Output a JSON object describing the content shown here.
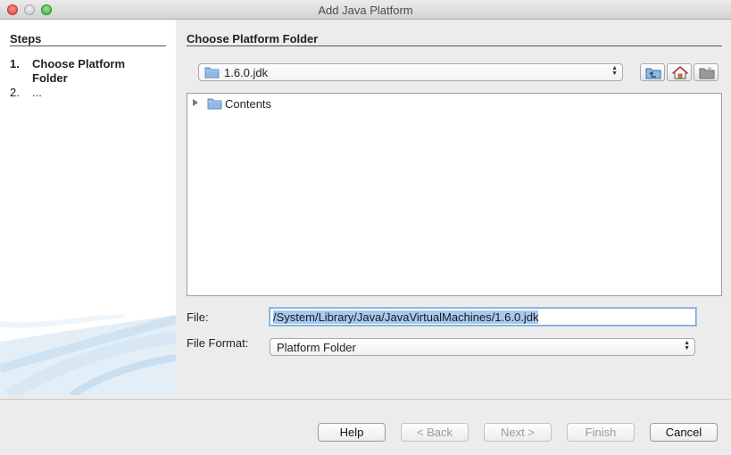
{
  "window": {
    "title": "Add Java Platform"
  },
  "steps": {
    "heading": "Steps",
    "items": [
      {
        "num": "1.",
        "label": "Choose Platform Folder",
        "active": true
      },
      {
        "num": "2.",
        "label": "...",
        "active": false
      }
    ]
  },
  "main": {
    "heading": "Choose Platform Folder",
    "folder_combo": {
      "value": "1.6.0.jdk",
      "icon": "folder-icon"
    },
    "toolbar": {
      "up_icon": "up-one-level-icon",
      "home_icon": "home-icon",
      "new_folder_icon": "new-folder-icon"
    },
    "tree": {
      "rows": [
        {
          "label": "Contents",
          "icon": "folder-icon",
          "expanded": false
        }
      ]
    },
    "file_label": "File:",
    "file_value": "/System/Library/Java/JavaVirtualMachines/1.6.0.jdk",
    "format_label": "File Format:",
    "format_value": "Platform Folder"
  },
  "buttons": {
    "help": "Help",
    "back": "< Back",
    "next": "Next >",
    "finish": "Finish",
    "cancel": "Cancel"
  },
  "colors": {
    "selection": "#a8c8f0",
    "focus_ring": "#7aa7d6",
    "folder": "#8fb9e3"
  }
}
